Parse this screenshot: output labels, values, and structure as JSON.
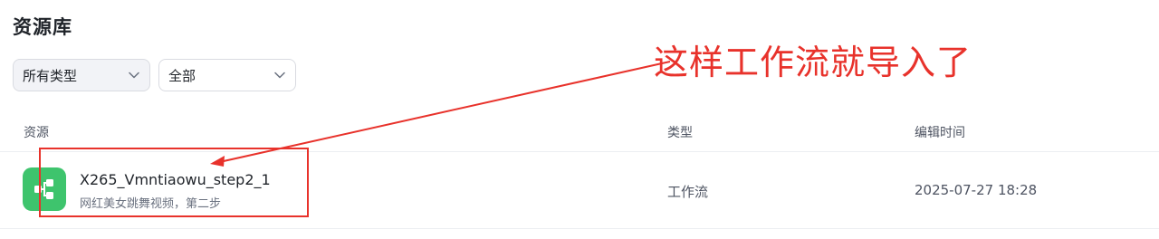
{
  "page": {
    "title": "资源库"
  },
  "filters": {
    "type_select": {
      "value": "所有类型"
    },
    "scope_select": {
      "value": "全部"
    }
  },
  "table": {
    "columns": {
      "resource": "资源",
      "type": "类型",
      "edit_time": "编辑时间"
    },
    "rows": [
      {
        "name": "X265_Vmntiaowu_step2_1",
        "description": "网红美女跳舞视频，第二步",
        "type": "工作流",
        "edit_time": "2025-07-27 18:28",
        "icon": "workflow-icon",
        "icon_color": "#3ec46d"
      }
    ]
  },
  "annotation": {
    "text": "这样工作流就导入了",
    "color": "#e8322b"
  }
}
